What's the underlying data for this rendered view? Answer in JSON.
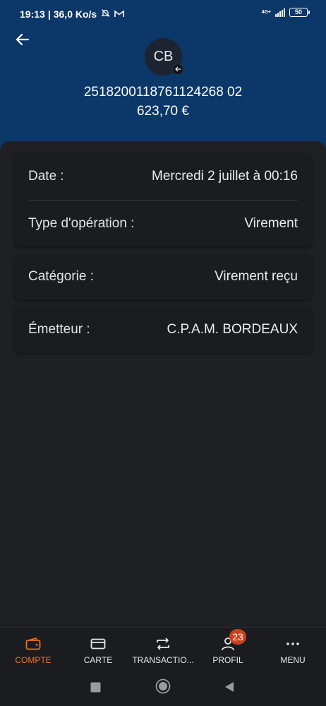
{
  "status_bar": {
    "time": "19:13",
    "separator": "|",
    "speed": "36,0 Ko/s",
    "network": "4G+",
    "battery": "50"
  },
  "header": {
    "avatar_initials": "CB",
    "account_number": "2518200118761124268 02",
    "amount": "623,70 €"
  },
  "details": {
    "date_label": "Date :",
    "date_value": "Mercredi 2 juillet à 00:16",
    "type_label": "Type d'opération :",
    "type_value": "Virement",
    "category_label": "Catégorie :",
    "category_value": "Virement reçu",
    "sender_label": "Émetteur :",
    "sender_value": "C.P.A.M. BORDEAUX"
  },
  "bottom_nav": {
    "compte": "COMPTE",
    "carte": "CARTE",
    "transactions": "TRANSACTIO...",
    "profil": "PROFIL",
    "profil_badge": "23",
    "menu": "MENU"
  },
  "colors": {
    "header_bg": "#0c3769",
    "accent": "#f0701e",
    "badge": "#c9411c",
    "surface": "#1b1c20"
  }
}
